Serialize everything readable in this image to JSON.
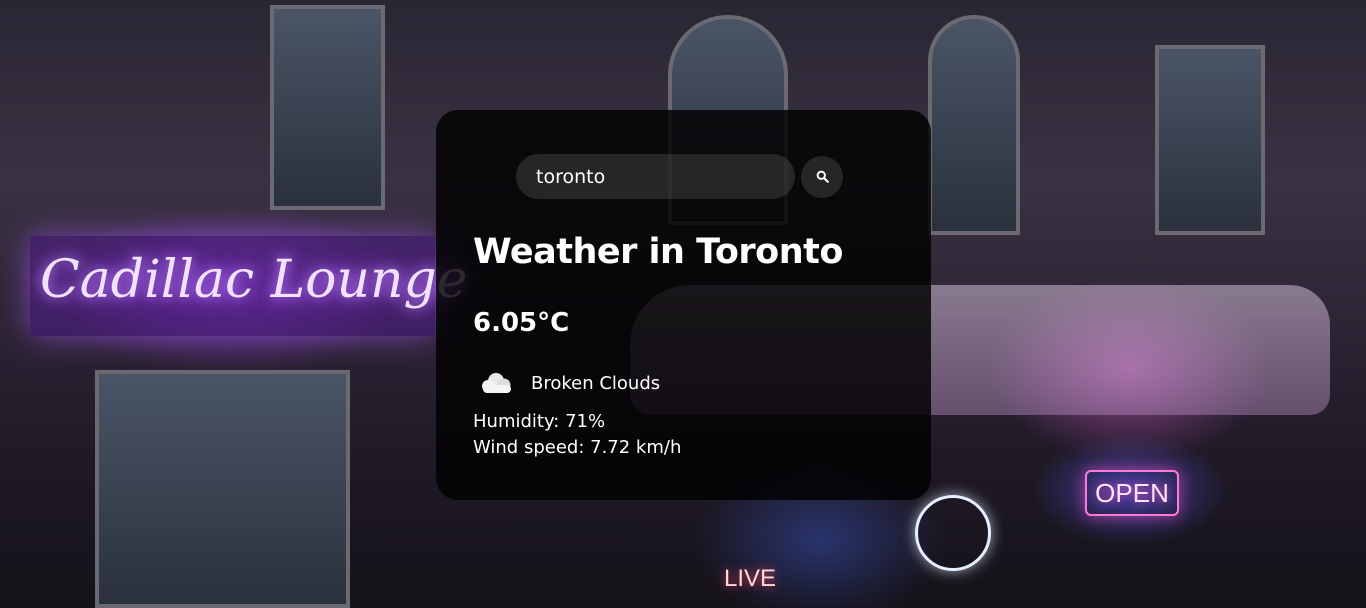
{
  "search": {
    "value": "toronto",
    "button_icon": "search-icon"
  },
  "weather": {
    "title": "Weather in Toronto",
    "temperature": "6.05°C",
    "icon": "cloud-icon",
    "description": "Broken Clouds",
    "humidity": "Humidity: 71%",
    "wind": "Wind speed: 7.72 km/h"
  },
  "background": {
    "sign_text": "Cadillac Lounge",
    "open_sign": "OPEN",
    "live_sign": "LIVE"
  },
  "colors": {
    "card_background": "#000000",
    "text": "#ffffff",
    "input_background": "#7c7c7c"
  }
}
